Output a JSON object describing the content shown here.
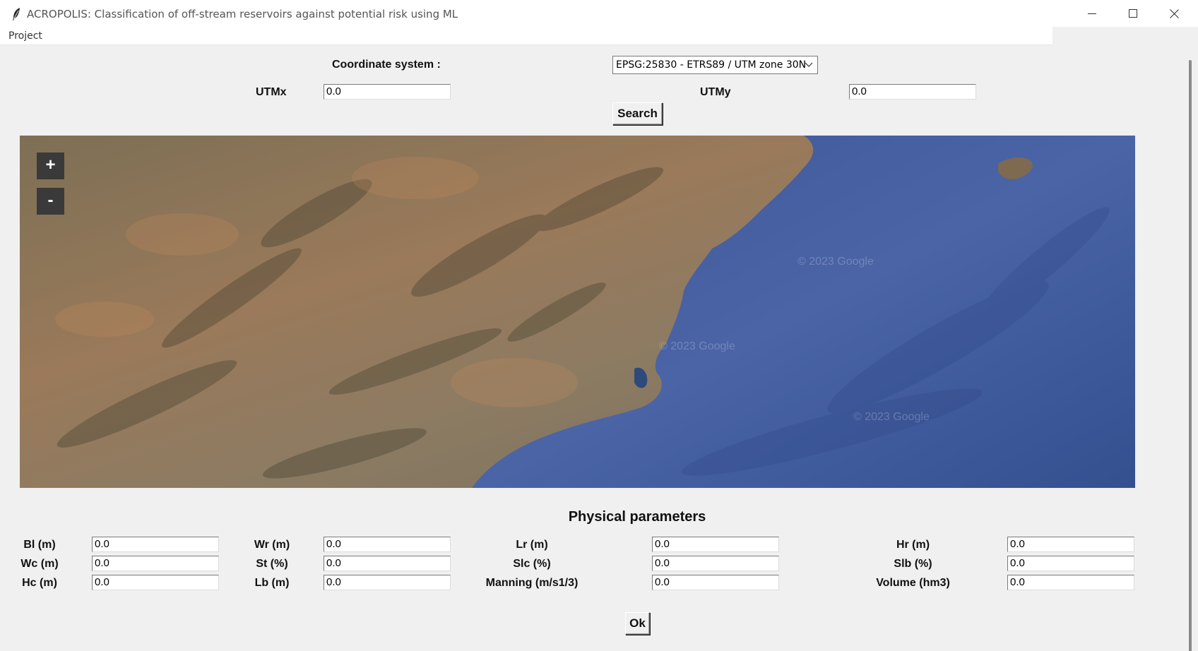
{
  "window": {
    "title": "ACROPOLIS: Classification of off-stream reservoirs against potential risk using ML",
    "controls": [
      "minimize-icon",
      "maximize-icon",
      "close-icon"
    ]
  },
  "menu": {
    "items": [
      "Project"
    ]
  },
  "header": {
    "coord_label": "Coordinate system :",
    "coord_value": "EPSG:25830 - ETRS89 / UTM zone 30N",
    "utmx_label": "UTMx",
    "utmx_value": "0.0",
    "utmy_label": "UTMy",
    "utmy_value": "0.0",
    "search_label": "Search"
  },
  "map": {
    "zoom_in": "+",
    "zoom_out": "-",
    "watermark": "© 2023 Google",
    "colors": {
      "land": "#8a7458",
      "sea": "#3f5a9b"
    }
  },
  "params": {
    "title": "Physical parameters",
    "rows": [
      [
        {
          "label": "Bl (m)",
          "value": "0.0"
        },
        {
          "label": "Wr (m)",
          "value": "0.0"
        },
        {
          "label": "Lr (m)",
          "value": "0.0"
        },
        {
          "label": "Hr (m)",
          "value": "0.0"
        }
      ],
      [
        {
          "label": "Wc (m)",
          "value": "0.0"
        },
        {
          "label": "St (%)",
          "value": "0.0"
        },
        {
          "label": "Slc (%)",
          "value": "0.0"
        },
        {
          "label": "Slb (%)",
          "value": "0.0"
        }
      ],
      [
        {
          "label": "Hc (m)",
          "value": "0.0"
        },
        {
          "label": "Lb (m)",
          "value": "0.0"
        },
        {
          "label": "Manning (m/s1/3)",
          "value": "0.0"
        },
        {
          "label": "Volume (hm3)",
          "value": "0.0"
        }
      ]
    ],
    "ok_label": "Ok"
  }
}
